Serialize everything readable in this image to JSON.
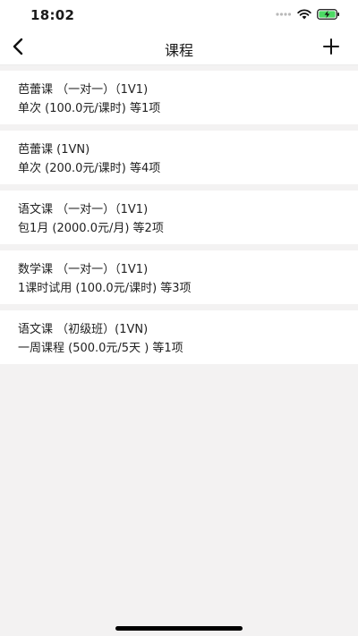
{
  "status_bar": {
    "time": "18:02",
    "icons": [
      "signal-dots-icon",
      "wifi-icon",
      "battery-charging-icon"
    ],
    "battery_color": "#4cd964"
  },
  "nav": {
    "back_icon": "chevron-left-icon",
    "title": "课程",
    "add_icon": "plus-icon"
  },
  "courses": [
    {
      "name": "芭蕾课 （一对一）（1V1)",
      "detail": "单次 (100.0元/课时) 等1项"
    },
    {
      "name": "芭蕾课 (1VN)",
      "detail": "单次 (200.0元/课时) 等4项"
    },
    {
      "name": "语文课 （一对一）（1V1)",
      "detail": "包1月 (2000.0元/月) 等2项"
    },
    {
      "name": "数学课 （一对一）（1V1)",
      "detail": "1课时试用 (100.0元/课时) 等3项"
    },
    {
      "name": "语文课 （初级班）(1VN)",
      "detail": "一周课程 (500.0元/5天 ) 等1项"
    }
  ]
}
